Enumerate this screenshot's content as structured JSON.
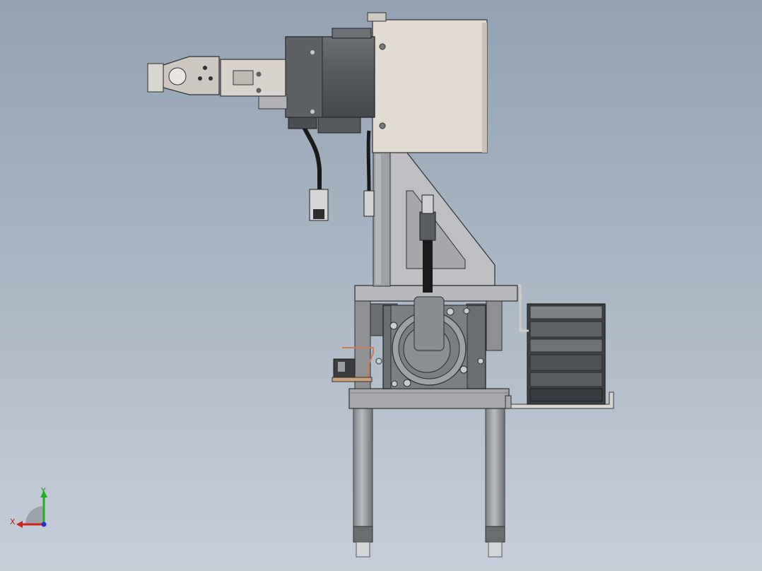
{
  "scene": {
    "background_top": "#93a1b2",
    "background_bottom": "#c6ced8",
    "part_light": "#e0d9d2",
    "part_grey": "#a9aaad",
    "motor_dark": "#5a5e62",
    "cable": "#1a1a1a"
  },
  "triad": {
    "x_label": "X",
    "y_label": "Y",
    "x_color": "#d42020",
    "y_color": "#20b020",
    "z_color": "#2030c8",
    "icon": "coordinate-triad-icon"
  }
}
